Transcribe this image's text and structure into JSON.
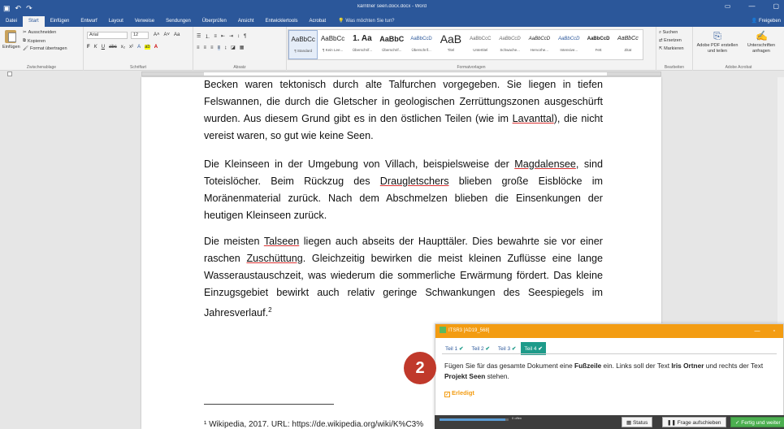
{
  "colors": {
    "word_blue": "#2b579a",
    "panel_orange": "#f39c12",
    "tab_teal": "#1e9b8a",
    "badge_red": "#c0392b",
    "green": "#4caf50"
  },
  "titlebar": {
    "doc_title": "kärntner seen.docx.docx - Word",
    "qat_icons": [
      "save-icon",
      "undo-icon",
      "redo-icon"
    ]
  },
  "ribbon_tabs": {
    "tabs": [
      "Datei",
      "Start",
      "Einfügen",
      "Entwurf",
      "Layout",
      "Verweise",
      "Sendungen",
      "Überprüfen",
      "Ansicht",
      "Entwicklertools",
      "Acrobat"
    ],
    "tell_me": "Was möchten Sie tun?",
    "share": "Freigeben"
  },
  "ribbon": {
    "clipboard": {
      "paste": "Einfügen",
      "cut": "Ausschneiden",
      "copy": "Kopieren",
      "format_painter": "Format übertragen",
      "label": "Zwischenablage"
    },
    "font": {
      "name": "Arial",
      "size": "12",
      "label": "Schriftart"
    },
    "paragraph": {
      "label": "Absatz"
    },
    "styles": {
      "label": "Formatvorlagen",
      "items": [
        {
          "sample": "AaBbCc",
          "name": "¶ Standard"
        },
        {
          "sample": "AaBbCc",
          "name": "¶ Kein Lee..."
        },
        {
          "sample": "1. Aa",
          "name": "Überschrif..."
        },
        {
          "sample": "AaBbC",
          "name": "Überschrif..."
        },
        {
          "sample": "AaBbCcD",
          "name": "Überschrif..."
        },
        {
          "sample": "AaB",
          "name": "Titel"
        },
        {
          "sample": "AaBbCcC",
          "name": "Untertitel"
        },
        {
          "sample": "AaBbCcD",
          "name": "Schwache..."
        },
        {
          "sample": "AaBbCcD",
          "name": "Hervorhe..."
        },
        {
          "sample": "AaBbCcD",
          "name": "Intensive..."
        },
        {
          "sample": "AaBbCcD",
          "name": "Fett"
        },
        {
          "sample": "AaBbCc",
          "name": "Zitat"
        }
      ]
    },
    "editing": {
      "find": "Suchen",
      "replace": "Ersetzen",
      "select": "Markieren",
      "label": "Bearbeiten"
    },
    "acrobat": {
      "create": "Adobe PDF erstellen und teilen",
      "sign": "Unterschriften anfragen",
      "label": "Adobe Acrobat"
    }
  },
  "document": {
    "p1": {
      "text": "Becken waren tektonisch durch alte Talfurchen vorgegeben. Sie liegen in tiefen Felswannen, die durch die Gletscher in geologischen Zerrüttungszonen ausgeschürft wurden. Aus diesem Grund gibt es in den östlichen Teilen (wie im ",
      "ul": "Lavanttal",
      "end": "), die nicht vereist waren, so gut wie keine Seen."
    },
    "p2": {
      "a": "Die Kleinseen in der Umgebung von Villach, beispielsweise der ",
      "ul1": "Magdalensee",
      "b": ", sind Toteislöcher. Beim Rückzug des ",
      "ul2": "Draugletschers",
      "c": " blieben große Eisblöcke im Moränenmaterial zurück. Nach dem Abschmelzen blieben die Einsenkungen der heutigen Kleinseen zurück."
    },
    "p3": {
      "a": "Die meisten ",
      "ul1": "Talseen",
      "b": " liegen auch abseits der Haupttäler. Dies bewahrte sie vor einer raschen ",
      "ul2": "Zuschüttung",
      "c": ". Gleichzeitig bewirken die meist kleinen Zuflüsse eine lange Wasseraustauschzeit, was wiederum die sommerliche Erwärmung fördert. Das kleine Einzugsgebiet bewirkt auch relativ geringe Schwankungen des Seespiegels im Jahresverlauf.",
      "sup": "2"
    },
    "footnote": "¹ Wikipedia, 2017. URL: https://de.wikipedia.org/wiki/K%C3%"
  },
  "task_panel": {
    "title": "ITSR3 [AD19_568]",
    "tabs": [
      {
        "label": "Teil 1",
        "check": "✔"
      },
      {
        "label": "Teil 2",
        "check": "✔"
      },
      {
        "label": "Teil 3",
        "check": "✔"
      },
      {
        "label": "Teil 4",
        "check": "✔"
      }
    ],
    "question": {
      "a": "Fügen Sie für das gesamte Dokument eine ",
      "b1": "Fußzeile",
      "c": " ein. Links soll der Text ",
      "b2": "Iris Ortner",
      "d": " und rechts der Text ",
      "b3": "Projekt Seen",
      "e": " stehen."
    },
    "done_label": "Erledigt",
    "badge": "2"
  },
  "status_strip": {
    "progress": 0.95,
    "open_label": "0 offen",
    "status_btn": "Status",
    "defer_btn": "Frage aufschieben",
    "finish_btn": "Fertig und weiter"
  }
}
